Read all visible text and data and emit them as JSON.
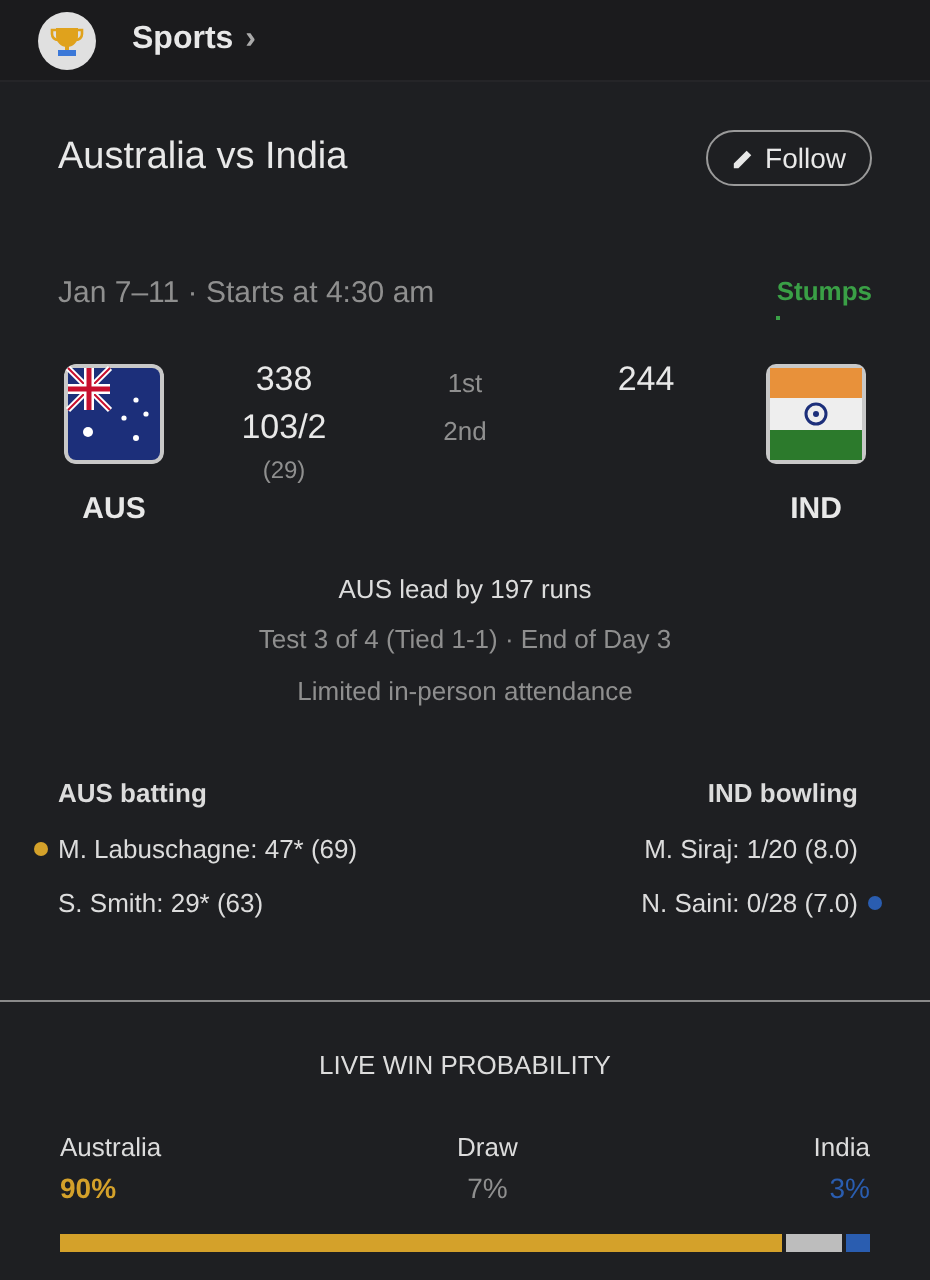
{
  "header": {
    "title": "Sports",
    "chevron": "›"
  },
  "match": {
    "title": "Australia vs India",
    "follow_button": "Follow",
    "date": "Jan 7–11 · Starts at 4:30 am",
    "status": "Stumps",
    "teams": [
      {
        "code": "AUS",
        "kind": "australia",
        "innings": [
          "338",
          "103/2"
        ],
        "overs": "(29)"
      },
      {
        "code": "IND",
        "kind": "india",
        "innings": [
          "244"
        ]
      }
    ],
    "innings_labels": [
      "1st",
      "2nd"
    ],
    "summary": "AUS lead by 197 runs",
    "series": "Test 3 of 4 (Tied 1-1) · End of Day 3",
    "note": "Limited in-person attendance"
  },
  "batting": {
    "title": "AUS batting",
    "players": [
      {
        "text": "M. Labuschagne: 47* (69)",
        "selected": true
      },
      {
        "text": "S. Smith: 29* (63)",
        "selected": false
      }
    ]
  },
  "bowling": {
    "title": "IND bowling",
    "players": [
      {
        "text": "M. Siraj: 1/20 (8.0)",
        "selected": false
      },
      {
        "text": "N. Saini: 0/28 (7.0)",
        "selected": true
      }
    ]
  },
  "win_probability": {
    "title": "LIVE WIN PROBABILITY",
    "outcomes": [
      {
        "label": "Australia",
        "value": "90%",
        "color": "#d4a12a"
      },
      {
        "label": "Draw",
        "value": "7%",
        "color": "#bdbdbd"
      },
      {
        "label": "India",
        "value": "3%",
        "color": "#2a5db0"
      }
    ]
  }
}
